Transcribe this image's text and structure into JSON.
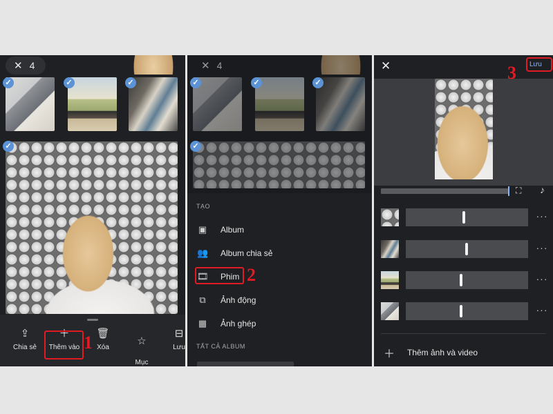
{
  "panel1": {
    "close_icon": "close-icon",
    "selected_count": "4",
    "actions": [
      {
        "label": "Chia sẻ",
        "icon": "share-icon"
      },
      {
        "label": "Thêm vào",
        "icon": "plus-icon"
      },
      {
        "label": "Xóa",
        "icon": "trash-icon"
      },
      {
        "label": "Mục\nưa thích",
        "icon": "star-icon"
      },
      {
        "label": "Lưu",
        "icon": "archive-icon"
      }
    ],
    "step": "1"
  },
  "panel2": {
    "selected_count": "4",
    "create_header": "TẠO",
    "menu": [
      {
        "label": "Album",
        "icon": "album-icon"
      },
      {
        "label": "Album chia sẻ",
        "icon": "shared-album-icon"
      },
      {
        "label": "Phim",
        "icon": "movie-icon"
      },
      {
        "label": "Ảnh động",
        "icon": "animation-icon"
      },
      {
        "label": "Ảnh ghép",
        "icon": "collage-icon"
      }
    ],
    "all_albums_header": "TẤT CẢ ALBUM",
    "step": "2"
  },
  "panel3": {
    "close_icon": "close-icon",
    "save_label": "Lưu",
    "add_label": "Thêm ảnh và video",
    "step": "3",
    "tracks": [
      {
        "thumb": "woman",
        "handle_position": 0.47
      },
      {
        "thumb": "desk",
        "handle_position": 0.5
      },
      {
        "thumb": "van",
        "handle_position": 0.45
      },
      {
        "thumb": "laptop",
        "handle_position": 0.45
      }
    ]
  },
  "colors": {
    "panel_bg": "#1f2023",
    "accent_check": "#5b93d6",
    "highlight_red": "#e01b24",
    "save_link": "#8ab4f8"
  }
}
